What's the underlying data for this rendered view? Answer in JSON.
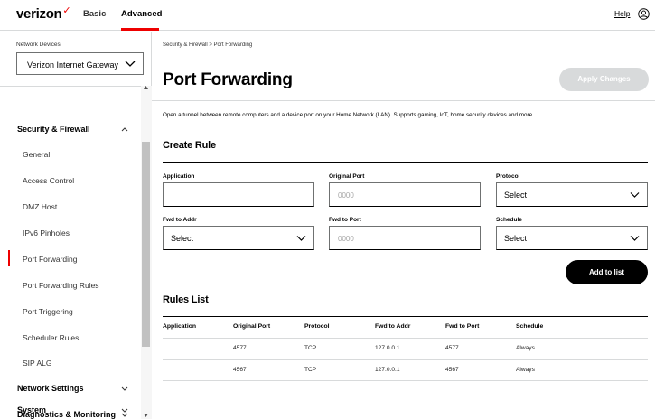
{
  "header": {
    "logo": "verizon",
    "logo_mark": "✓",
    "tabs": [
      {
        "label": "Basic"
      },
      {
        "label": "Advanced"
      }
    ],
    "help_label": "Help",
    "accent_color": "#ee0000"
  },
  "sidebar": {
    "device_label": "Network Devices",
    "device_value": "Verizon Internet Gateway",
    "sections": [
      {
        "label": "Security & Firewall",
        "expanded": true
      },
      {
        "label": "Network Settings"
      },
      {
        "label": "Diagnostics & Monitoring"
      },
      {
        "label": "System"
      }
    ],
    "items": [
      {
        "label": "General"
      },
      {
        "label": "Access Control"
      },
      {
        "label": "DMZ Host"
      },
      {
        "label": "IPv6 Pinholes"
      },
      {
        "label": "Port Forwarding",
        "active": true
      },
      {
        "label": "Port Forwarding Rules"
      },
      {
        "label": "Port Triggering"
      },
      {
        "label": "Scheduler Rules"
      },
      {
        "label": "SIP ALG"
      }
    ]
  },
  "main": {
    "breadcrumb": {
      "parent": "Security & Firewall",
      "separator": ">",
      "current": "Port Forwarding"
    },
    "title": "Port Forwarding",
    "apply_label": "Apply Changes",
    "description": "Open a tunnel between remote computers and a device port on your Home Network (LAN). Supports gaming, IoT, home security devices and more.",
    "create_rule": {
      "title": "Create Rule",
      "application_label": "Application",
      "application_value": "",
      "original_port_label": "Original Port",
      "original_port_placeholder": "0000",
      "protocol_label": "Protocol",
      "protocol_value": "Select",
      "fwd_addr_label": "Fwd to Addr",
      "fwd_addr_value": "Select",
      "fwd_port_label": "Fwd to Port",
      "fwd_port_placeholder": "0000",
      "schedule_label": "Schedule",
      "schedule_value": "Select",
      "add_label": "Add to list"
    },
    "rules_list": {
      "title": "Rules List",
      "columns": [
        "Application",
        "Original Port",
        "Protocol",
        "Fwd to Addr",
        "Fwd to Port",
        "Schedule"
      ],
      "rows": [
        [
          "",
          "4577",
          "TCP",
          "127.0.0.1",
          "4577",
          "Always"
        ],
        [
          "",
          "4567",
          "TCP",
          "127.0.0.1",
          "4567",
          "Always"
        ]
      ]
    }
  }
}
